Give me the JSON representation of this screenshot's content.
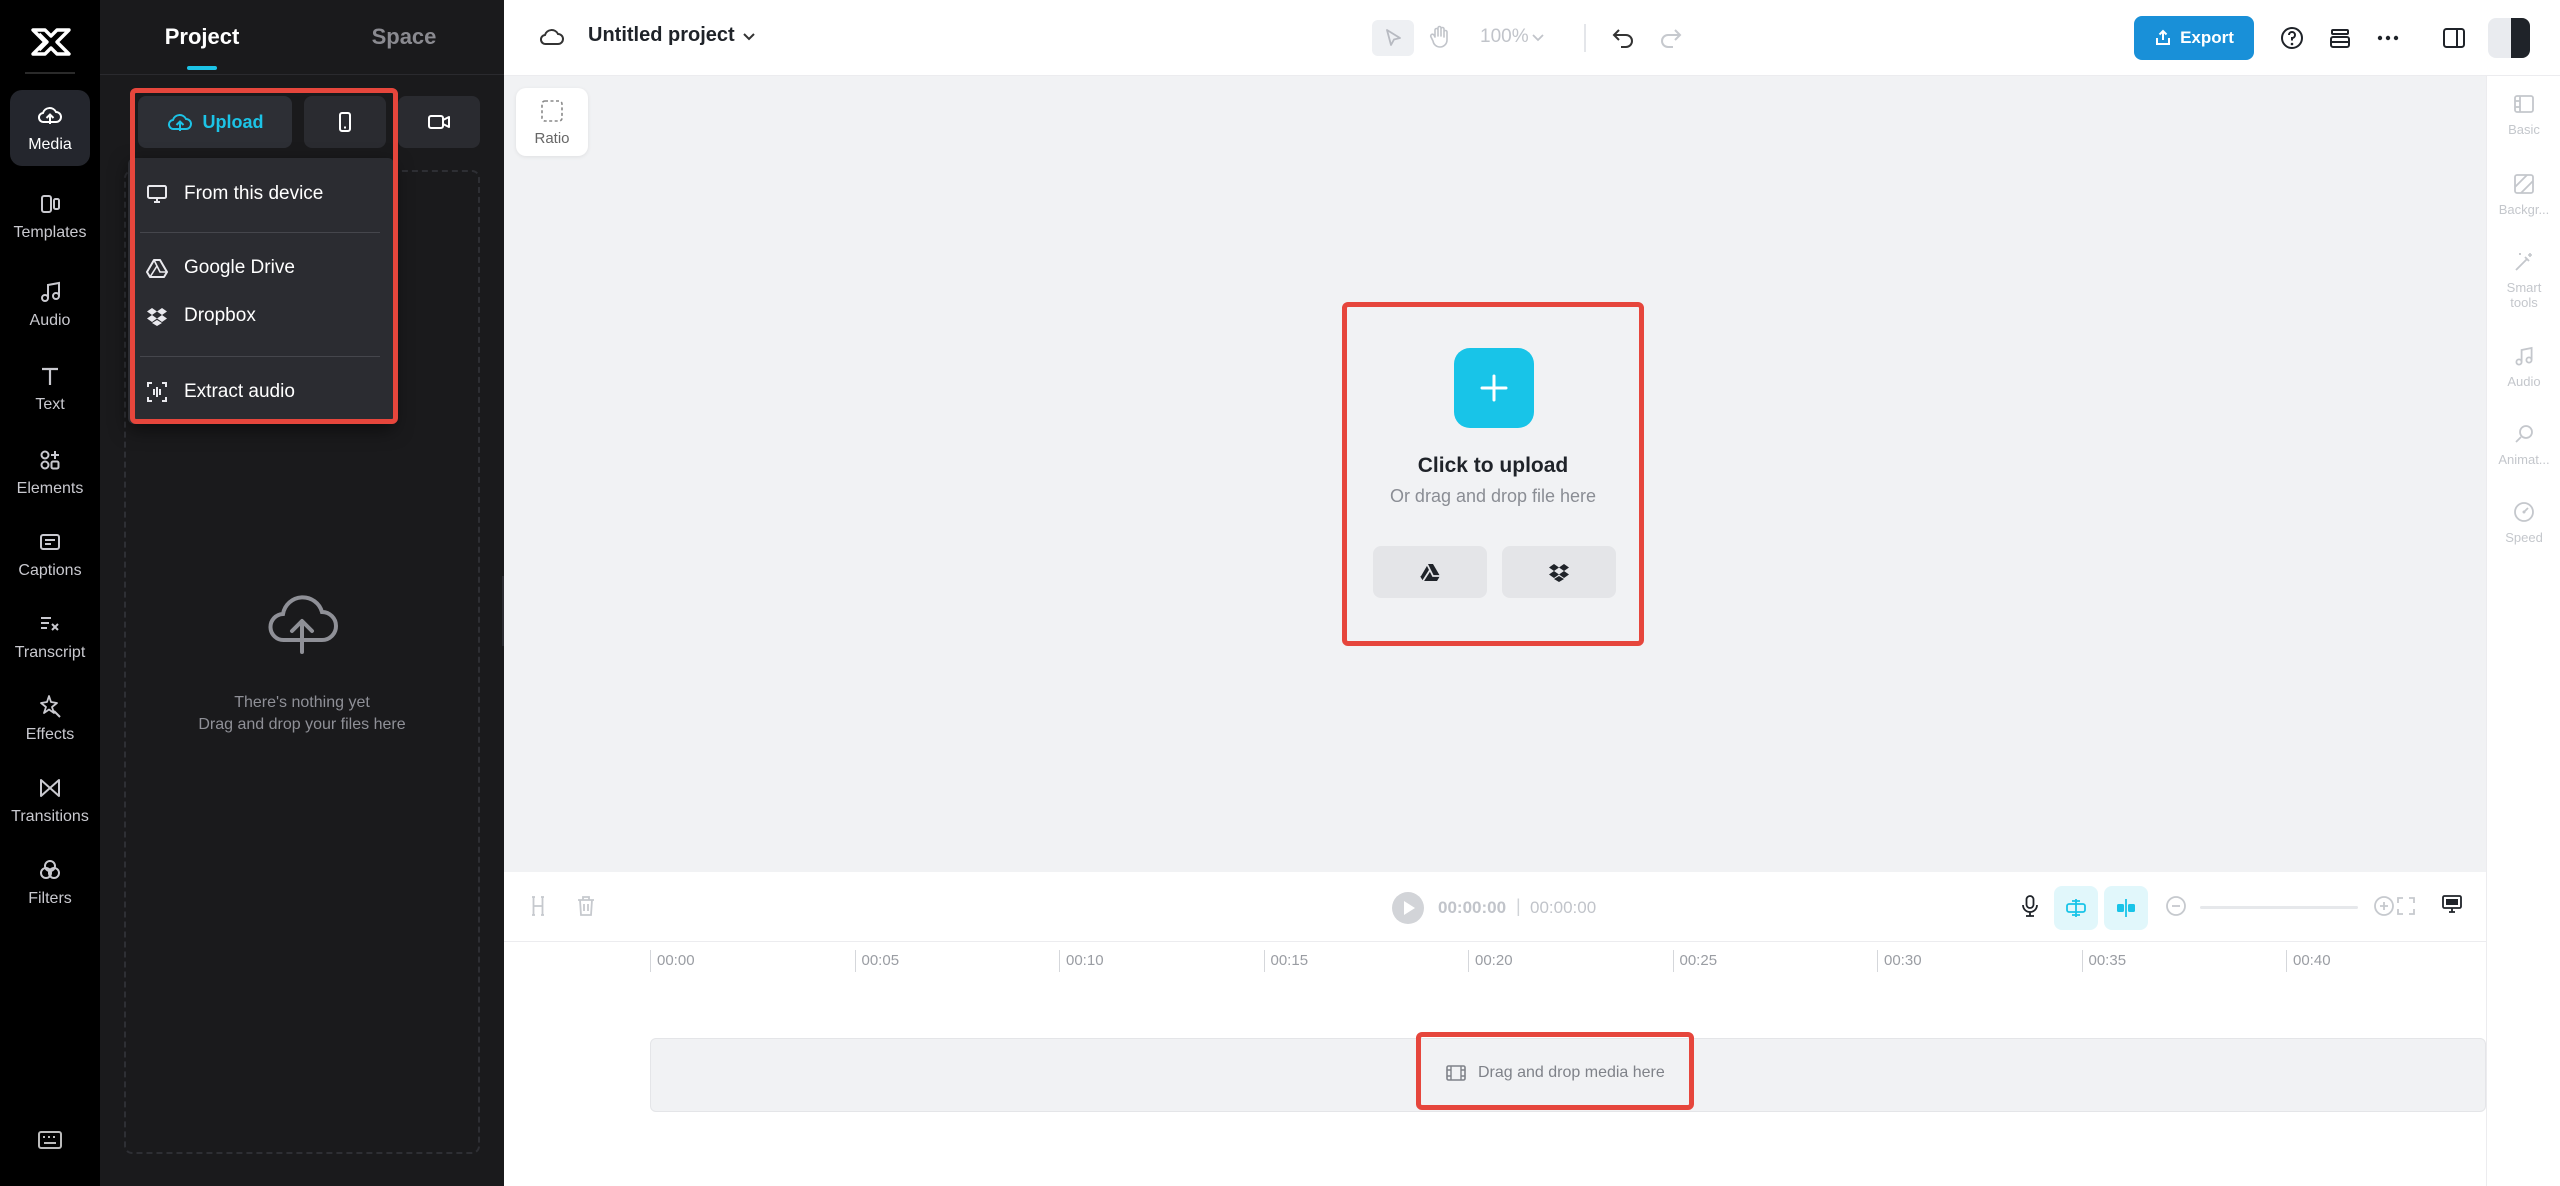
{
  "rail": {
    "items": [
      {
        "label": "Media",
        "icon": "media-cloud-icon"
      },
      {
        "label": "Templates",
        "icon": "templates-icon"
      },
      {
        "label": "Audio",
        "icon": "music-note-icon"
      },
      {
        "label": "Text",
        "icon": "text-t-icon"
      },
      {
        "label": "Elements",
        "icon": "elements-icon"
      },
      {
        "label": "Captions",
        "icon": "captions-icon"
      },
      {
        "label": "Transcript",
        "icon": "transcript-icon"
      },
      {
        "label": "Effects",
        "icon": "effects-icon"
      },
      {
        "label": "Transitions",
        "icon": "transitions-icon"
      },
      {
        "label": "Filters",
        "icon": "filters-icon"
      }
    ]
  },
  "panel": {
    "tabs": {
      "project": "Project",
      "space": "Space"
    },
    "upload_label": "Upload",
    "empty_line1": "There's nothing yet",
    "empty_line2": "Drag and drop your files here"
  },
  "upload_menu": {
    "from_device": "From this device",
    "google_drive": "Google Drive",
    "dropbox": "Dropbox",
    "extract_audio": "Extract audio"
  },
  "topbar": {
    "project_title": "Untitled project",
    "zoom": "100%",
    "export_label": "Export"
  },
  "canvas": {
    "ratio_label": "Ratio",
    "click_to_upload": "Click to upload",
    "or_drag": "Or drag and drop file here"
  },
  "right_rail": {
    "items": [
      {
        "label": "Basic"
      },
      {
        "label": "Backgr..."
      },
      {
        "label": "Smart tools"
      },
      {
        "label": "Audio"
      },
      {
        "label": "Animat..."
      },
      {
        "label": "Speed"
      }
    ]
  },
  "playback": {
    "current_time": "00:00:00",
    "separator": "|",
    "total_time": "00:00:00"
  },
  "timeline": {
    "ticks": [
      "00:00",
      "00:05",
      "00:10",
      "00:15",
      "00:20",
      "00:25",
      "00:30",
      "00:35",
      "00:40"
    ],
    "track_hint": "Drag and drop media here"
  },
  "colors": {
    "accent": "#18c4e8",
    "export": "#1990d8",
    "highlight": "#e6463c"
  }
}
